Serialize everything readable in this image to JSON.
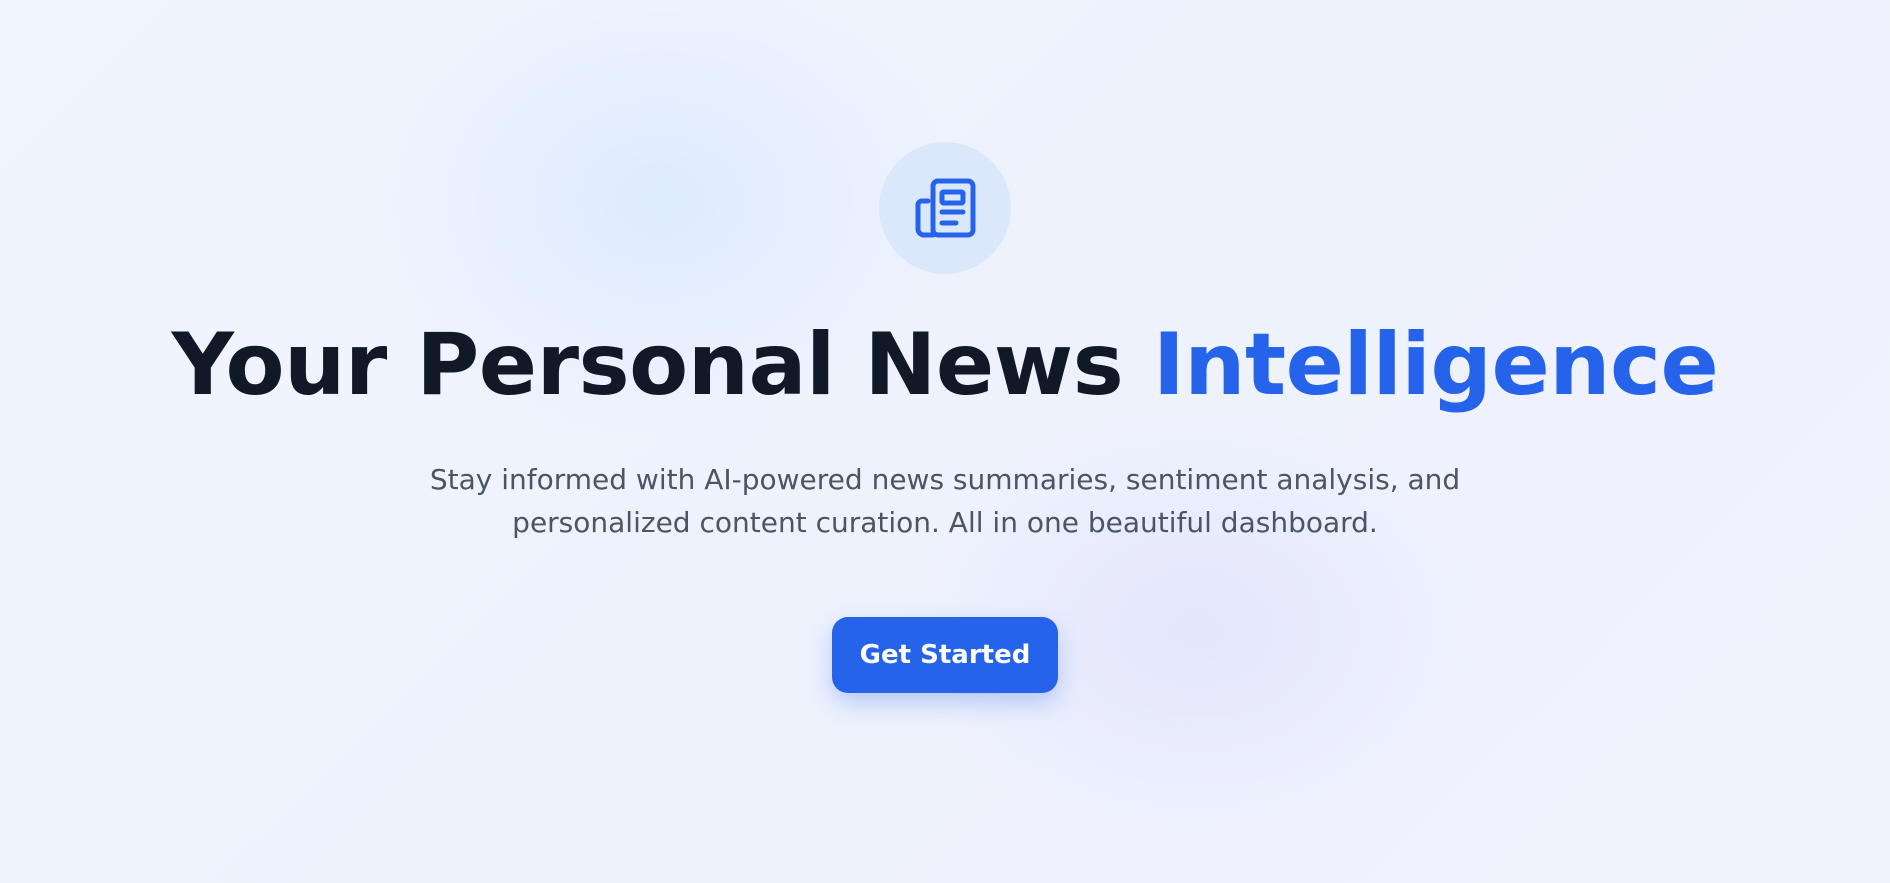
{
  "hero": {
    "icon": "newspaper-icon",
    "headline_main": "Your Personal News ",
    "headline_accent": "Intelligence",
    "subtitle_line1": "Stay informed with AI-powered news summaries, sentiment analysis, and",
    "subtitle_line2": "personalized content curation. All in one beautiful dashboard.",
    "cta_label": "Get Started"
  },
  "colors": {
    "accent": "#2563eb",
    "heading": "#111827",
    "body_text": "#4b5563",
    "icon_background": "#dbe8fc"
  }
}
